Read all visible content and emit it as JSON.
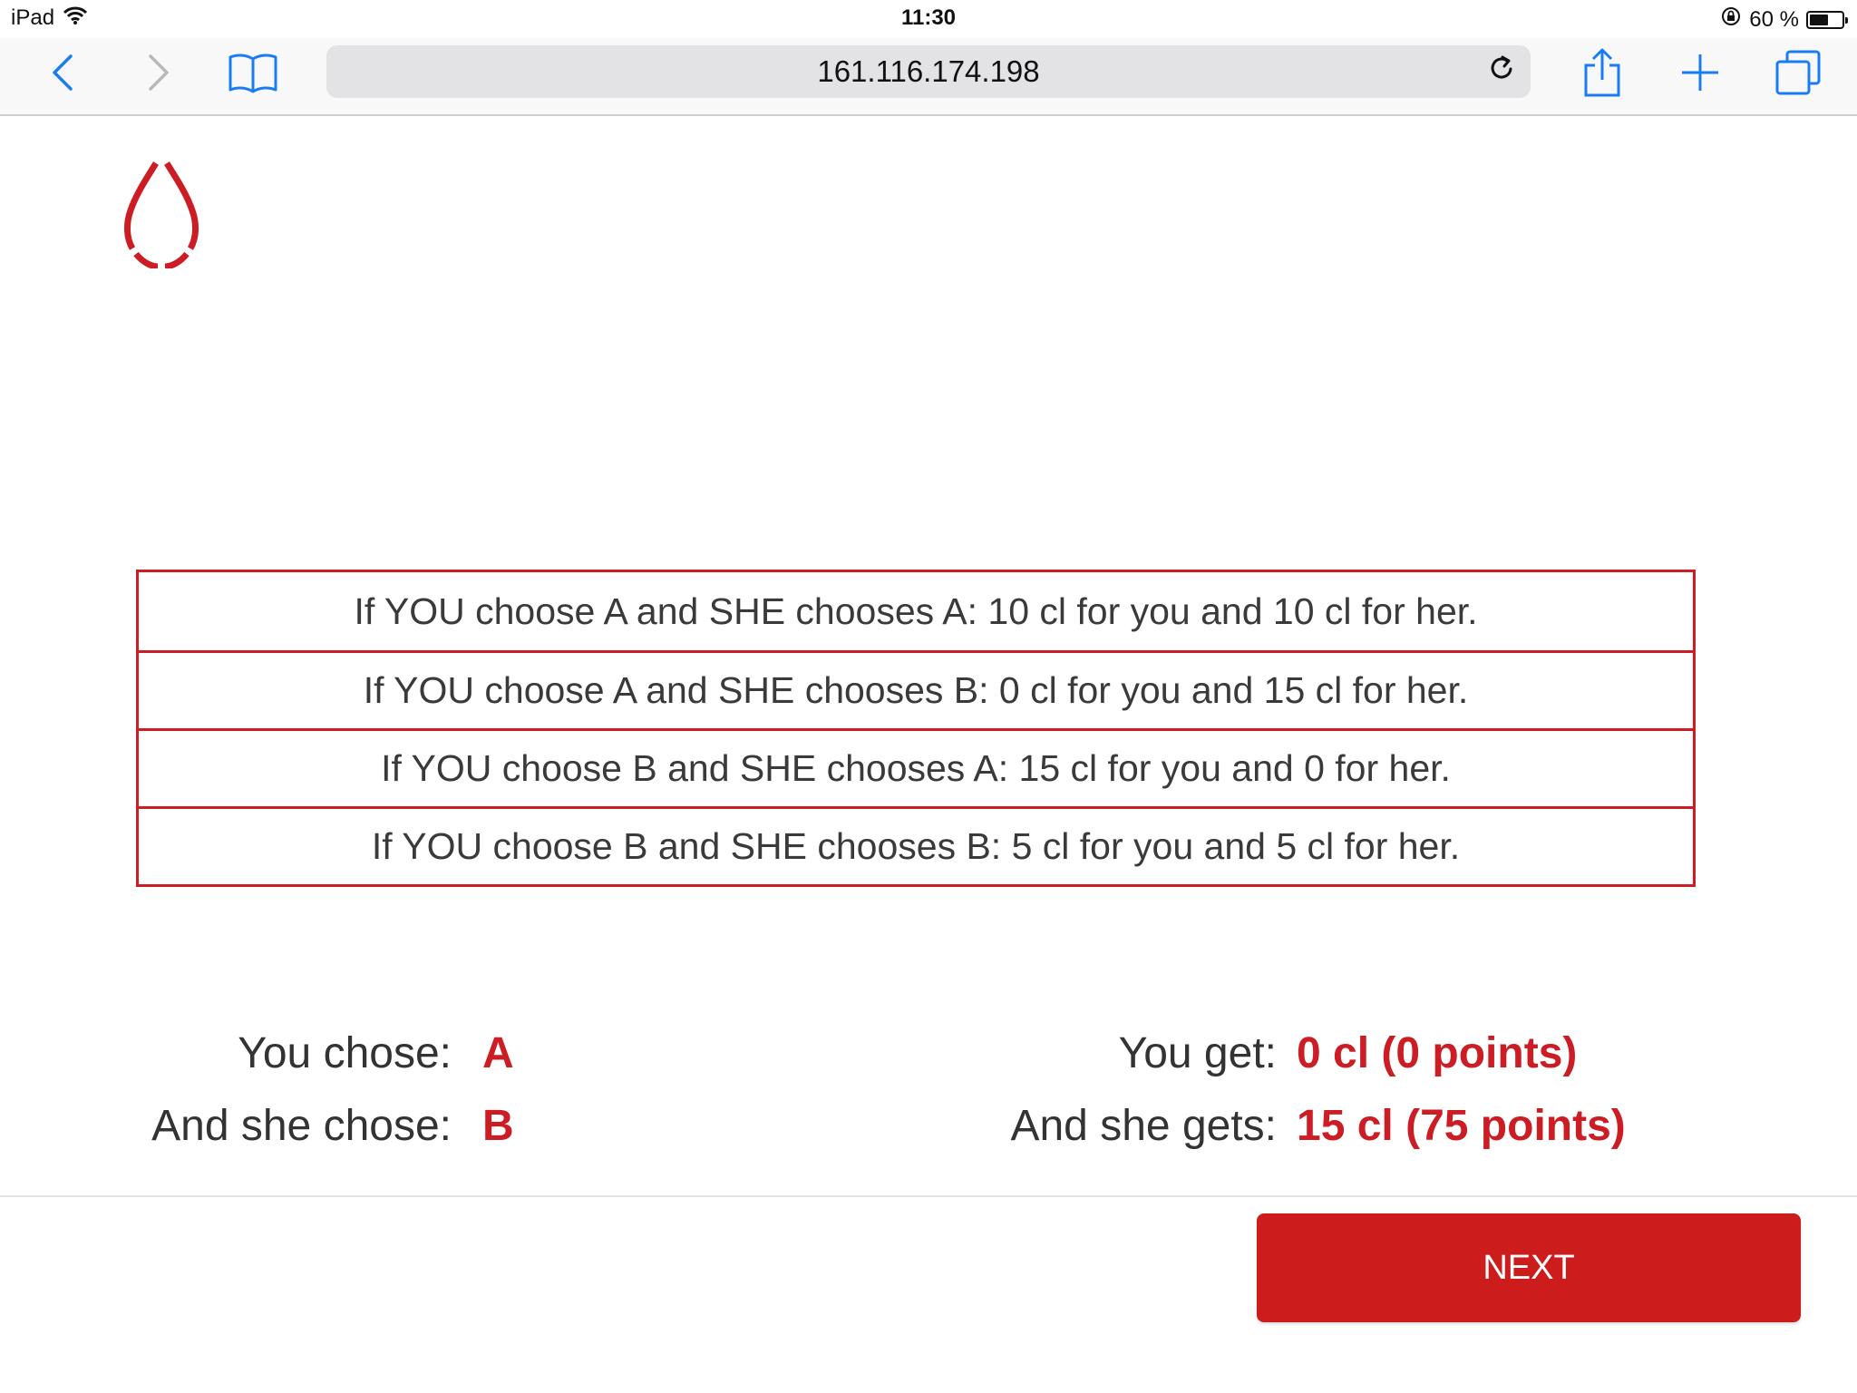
{
  "status_bar": {
    "device": "iPad",
    "time": "11:30",
    "battery_text": "60 %",
    "battery_level": 0.6
  },
  "browser": {
    "url": "161.116.174.198",
    "icons": {
      "back": "chevron-left-icon",
      "forward": "chevron-right-icon",
      "bookmarks": "book-icon",
      "reload": "reload-icon",
      "share": "share-icon",
      "new_tab": "plus-icon",
      "tabs": "tabs-icon"
    },
    "accent_color": "#1a7cf5"
  },
  "logo": {
    "icon": "blood-drop-icon",
    "color": "#cc1c24"
  },
  "payoff_table": {
    "rows": [
      "If YOU choose A and SHE chooses A: 10 cl for you and 10 cl for her.",
      "If YOU choose A and SHE chooses B: 0 cl for you and 15 cl for her.",
      "If YOU choose B and SHE chooses A: 15 cl for you and 0 for her.",
      "If YOU choose B and SHE chooses B: 5 cl for you and 5 cl for her."
    ]
  },
  "results": {
    "you_chose_label": "You chose:",
    "you_chose_value": "A",
    "she_chose_label": "And she chose:",
    "she_chose_value": "B",
    "you_get_label": "You get:",
    "you_get_value": "0 cl (0 points)",
    "she_gets_label": "And she gets:",
    "she_gets_value": "15 cl (75 points)"
  },
  "next_button": {
    "label": "NEXT",
    "color": "#cc1c1c"
  }
}
